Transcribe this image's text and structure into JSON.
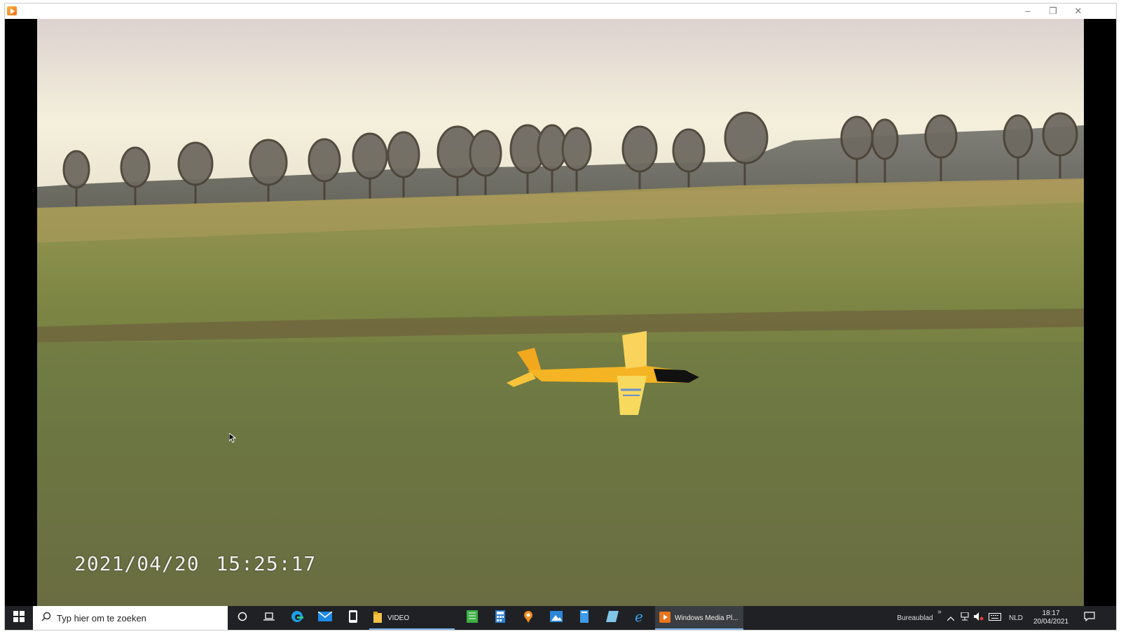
{
  "window": {
    "minimize_glyph": "–",
    "restore_glyph": "❐",
    "close_glyph": "✕"
  },
  "video": {
    "timestamp": "2021/04/20  15:25:17"
  },
  "taskbar": {
    "search_placeholder": "Typ hier om te zoeken",
    "folder_label": "VIDEO",
    "media_player_label": "Windows Media Pl...",
    "desktop_label": "Bureaublad",
    "language": "NLD",
    "time": "18:17",
    "date": "20/04/2021"
  },
  "icons": [
    "windows-logo-icon",
    "search-icon",
    "cortana-icon",
    "task-view-icon",
    "edge-icon",
    "mail-icon",
    "phone-icon",
    "folder-icon",
    "spreadsheet-icon",
    "calculator-icon",
    "maps-icon",
    "photos-icon",
    "notepad-icon",
    "paint-icon",
    "internet-explorer-icon",
    "media-player-icon",
    "chevron-up-icon",
    "network-icon",
    "volume-icon",
    "keyboard-icon",
    "notification-icon"
  ],
  "colors": {
    "taskbar_bg": "#1f2125",
    "accent": "#7fb4ea",
    "plane_yellow": "#f5c518"
  }
}
